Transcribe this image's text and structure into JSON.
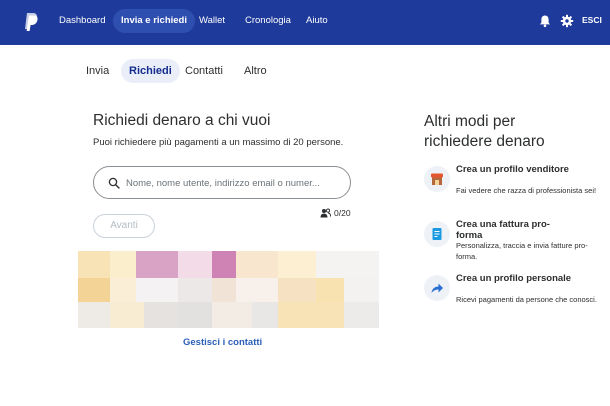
{
  "header": {
    "nav": [
      {
        "label": "Dashboard"
      },
      {
        "label": "Invia e richiedi"
      },
      {
        "label": "Wallet"
      },
      {
        "label": "Cronologia"
      },
      {
        "label": "Aiuto"
      }
    ],
    "logout_label": "ESCI",
    "icons": [
      "paypal-logo",
      "bell-icon",
      "gear-icon"
    ]
  },
  "subnav": {
    "tabs": [
      {
        "label": "Invia"
      },
      {
        "label": "Richiedi"
      },
      {
        "label": "Contatti"
      },
      {
        "label": "Altro"
      }
    ],
    "active": "Richiedi"
  },
  "request": {
    "title": "Richiedi denaro a chi vuoi",
    "subtitle": "Puoi richiedere più pagamenti a un massimo di 20 persone.",
    "search_placeholder": "Nome, nome utente, indirizzo email o numer...",
    "search_value": "",
    "counter": "0/20",
    "next_label": "Avanti",
    "manage_contacts_label": "Gestisci i contatti"
  },
  "sidebar": {
    "title": "Altri modi per richiedere denaro",
    "items": [
      {
        "title": "Crea un profilo venditore",
        "description": "Fai vedere che razza di professionista sei!",
        "icon": "store-icon"
      },
      {
        "title": "Crea una fattura pro-forma",
        "description": "Personalizza, traccia e invia fatture pro-forma.",
        "icon": "invoice-icon"
      },
      {
        "title": "Crea un profilo personale",
        "description": "Ricevi pagamenti da persone che conosci.",
        "icon": "share-arrow-icon"
      }
    ]
  },
  "colors": {
    "header_bg": "#1e3a9a",
    "active_nav_bg": "#2f4fb0",
    "link": "#2b5fb8",
    "active_tab_bg": "#e9eef8"
  }
}
